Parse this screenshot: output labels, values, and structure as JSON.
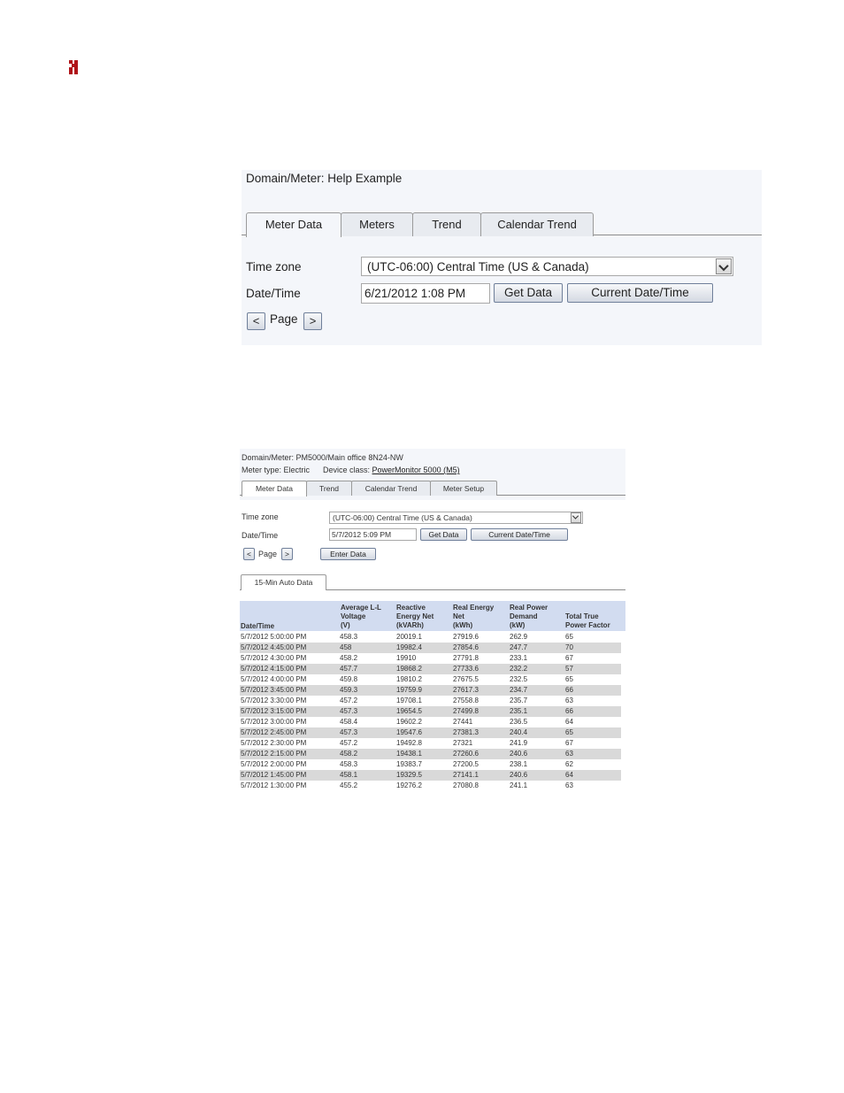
{
  "panel1": {
    "domain_meter_label": "Domain/Meter: Help Example",
    "tabs": [
      "Meter Data",
      "Meters",
      "Trend",
      "Calendar Trend"
    ],
    "timezone_label": "Time zone",
    "timezone_value": "(UTC-06:00) Central Time (US & Canada)",
    "datetime_label": "Date/Time",
    "datetime_value": "6/21/2012 1:08 PM",
    "get_data_label": "Get Data",
    "current_datetime_label": "Current Date/Time",
    "prev_page": "<",
    "page_label": "Page",
    "next_page": ">"
  },
  "panel2": {
    "domain_meter_label": "Domain/Meter: PM5000/Main office 8N24-NW",
    "meter_type_label": "Meter type: Electric",
    "device_class_label": "Device class:",
    "device_class_link": "PowerMonitor 5000 (M5)",
    "tabs": [
      "Meter Data",
      "Trend",
      "Calendar Trend",
      "Meter Setup"
    ],
    "timezone_label": "Time zone",
    "timezone_value": "(UTC-06:00) Central Time (US & Canada)",
    "datetime_label": "Date/Time",
    "datetime_value": "5/7/2012 5:09 PM",
    "get_data_label": "Get Data",
    "current_datetime_label": "Current Date/Time",
    "prev_page": "<",
    "page_label": "Page",
    "next_page": ">",
    "enter_data_label": "Enter Data",
    "subtab": "15-Min Auto Data",
    "table": {
      "headers": [
        [
          "Date/Time"
        ],
        [
          "Average L-L",
          "Voltage",
          "(V)"
        ],
        [
          "Reactive",
          "Energy Net",
          "(kVARh)"
        ],
        [
          "Real Energy",
          "Net",
          "(kWh)"
        ],
        [
          "Real Power",
          "Demand",
          "(kW)"
        ],
        [
          "Total True",
          "Power Factor"
        ]
      ],
      "rows": [
        [
          "5/7/2012 5:00:00 PM",
          "458.3",
          "20019.1",
          "27919.6",
          "262.9",
          "65"
        ],
        [
          "5/7/2012 4:45:00 PM",
          "458",
          "19982.4",
          "27854.6",
          "247.7",
          "70"
        ],
        [
          "5/7/2012 4:30:00 PM",
          "458.2",
          "19910",
          "27791.8",
          "233.1",
          "67"
        ],
        [
          "5/7/2012 4:15:00 PM",
          "457.7",
          "19868.2",
          "27733.6",
          "232.2",
          "57"
        ],
        [
          "5/7/2012 4:00:00 PM",
          "459.8",
          "19810.2",
          "27675.5",
          "232.5",
          "65"
        ],
        [
          "5/7/2012 3:45:00 PM",
          "459.3",
          "19759.9",
          "27617.3",
          "234.7",
          "66"
        ],
        [
          "5/7/2012 3:30:00 PM",
          "457.2",
          "19708.1",
          "27558.8",
          "235.7",
          "63"
        ],
        [
          "5/7/2012 3:15:00 PM",
          "457.3",
          "19654.5",
          "27499.8",
          "235.1",
          "66"
        ],
        [
          "5/7/2012 3:00:00 PM",
          "458.4",
          "19602.2",
          "27441",
          "236.5",
          "64"
        ],
        [
          "5/7/2012 2:45:00 PM",
          "457.3",
          "19547.6",
          "27381.3",
          "240.4",
          "65"
        ],
        [
          "5/7/2012 2:30:00 PM",
          "457.2",
          "19492.8",
          "27321",
          "241.9",
          "67"
        ],
        [
          "5/7/2012 2:15:00 PM",
          "458.2",
          "19438.1",
          "27260.6",
          "240.6",
          "63"
        ],
        [
          "5/7/2012 2:00:00 PM",
          "458.3",
          "19383.7",
          "27200.5",
          "238.1",
          "62"
        ],
        [
          "5/7/2012 1:45:00 PM",
          "458.1",
          "19329.5",
          "27141.1",
          "240.6",
          "64"
        ],
        [
          "5/7/2012 1:30:00 PM",
          "455.2",
          "19276.2",
          "27080.8",
          "241.1",
          "63"
        ]
      ]
    }
  },
  "colors": {
    "accent": "#b01419",
    "table_header": "#d2dcf0",
    "row_alt": "#d9d9d9"
  },
  "icons": {
    "corner": "logo-icon",
    "dropdown": "chevron-down-icon"
  }
}
